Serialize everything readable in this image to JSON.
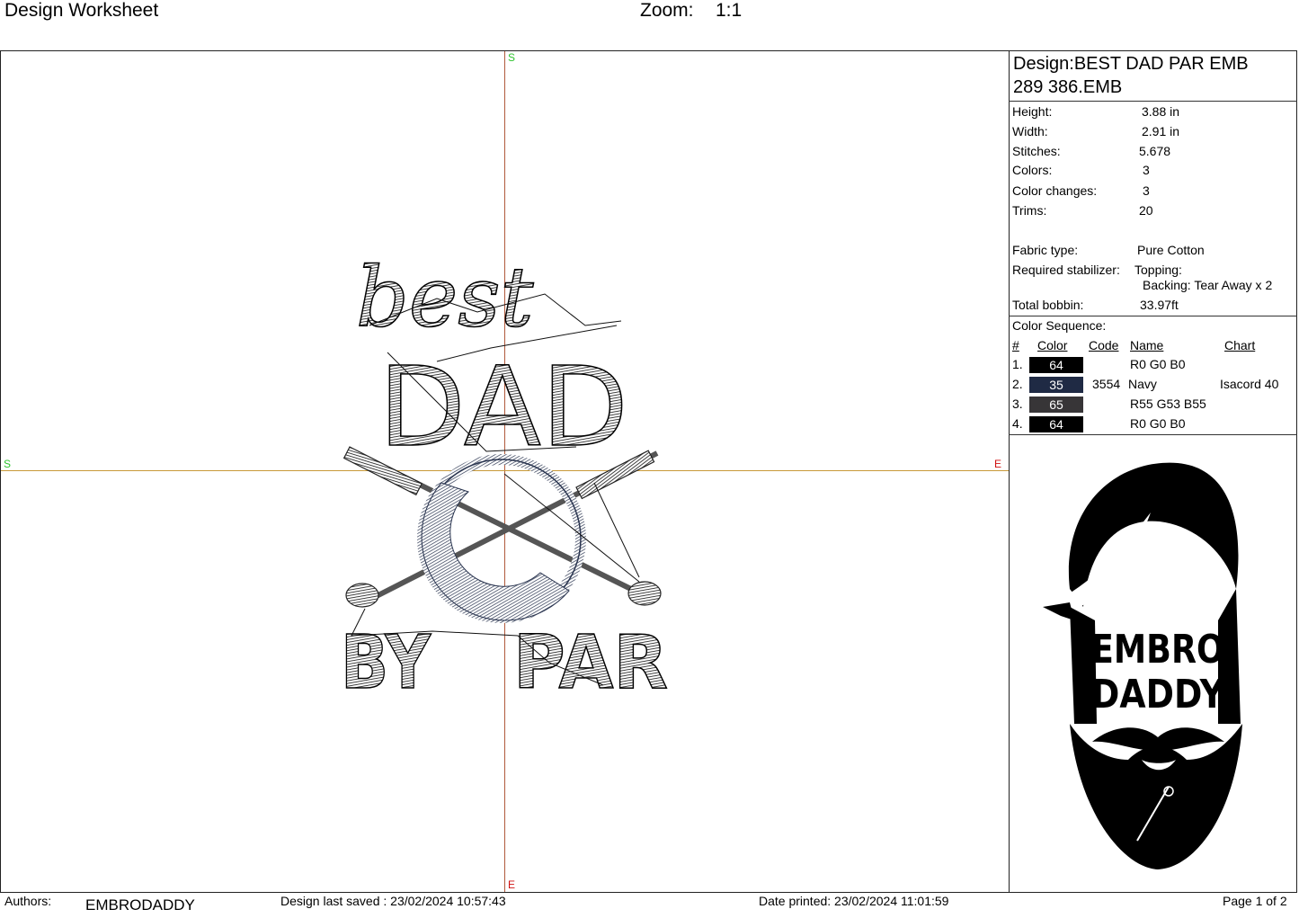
{
  "header": {
    "title": "Design Worksheet",
    "zoom_label": "Zoom:",
    "zoom_value": "1:1"
  },
  "canvas": {
    "markers": {
      "top": "S",
      "left": "S",
      "right": "E",
      "bottom": "E"
    },
    "design_text": {
      "line1": "best",
      "line2": "DAD",
      "line3a": "BY",
      "line3b": "PAR"
    },
    "colors": {
      "guide_vertical": "#b05a3c",
      "guide_horizontal": "#c89a3a",
      "thread_black": "#000000",
      "thread_navy": "#2a3550"
    }
  },
  "panel": {
    "design_name": "Design:BEST DAD PAR EMB 289 386.EMB",
    "stats": [
      {
        "label": "Height:",
        "value": "3.88 in"
      },
      {
        "label": "Width:",
        "value": "2.91 in"
      },
      {
        "label": "Stitches:",
        "value": "5.678"
      },
      {
        "label": "Colors:",
        "value": "3"
      },
      {
        "label": "Color changes:",
        "value": "3"
      },
      {
        "label": "Trims:",
        "value": "20"
      }
    ],
    "fabric_label": "Fabric type:",
    "fabric_value": "Pure Cotton",
    "stabilizer_label": "Required stabilizer:",
    "topping": "Topping:",
    "backing": "Backing: Tear Away x 2",
    "bobbin_label": "Total bobbin:",
    "bobbin_value": "33.97ft",
    "color_sequence_title": "Color Sequence:",
    "columns": {
      "num": "#",
      "color": "Color",
      "code": "Code",
      "name": "Name",
      "chart": "Chart"
    },
    "rows": [
      {
        "num": "1.",
        "color": "64",
        "code": "",
        "name": "R0 G0 B0",
        "chart": "",
        "hex": "#000000"
      },
      {
        "num": "2.",
        "color": "35",
        "code": "3554",
        "name": "Navy",
        "chart": "Isacord 40",
        "hex": "#1f2a44"
      },
      {
        "num": "3.",
        "color": "65",
        "code": "",
        "name": "R55 G53 B55",
        "chart": "",
        "hex": "#373537"
      },
      {
        "num": "4.",
        "color": "64",
        "code": "",
        "name": "R0 G0 B0",
        "chart": "",
        "hex": "#000000"
      }
    ],
    "logo": {
      "line1": "EMBRO",
      "line2": "DADDY"
    }
  },
  "footer": {
    "authors_label": "Authors:",
    "authors_value": "EMBRODADDY",
    "saved": "Design last saved : 23/02/2024 10:57:43",
    "printed": "Date printed: 23/02/2024 11:01:59",
    "page": "Page 1 of 2"
  }
}
